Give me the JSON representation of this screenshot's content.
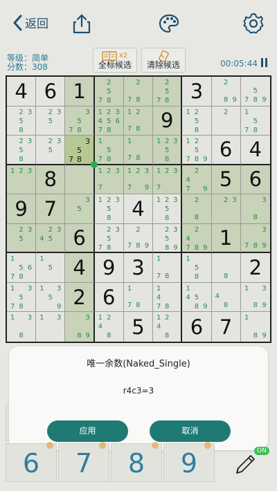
{
  "header": {
    "back_label": "返回",
    "icons": [
      "chevron-left-icon",
      "share-icon",
      "palette-icon",
      "gear-icon"
    ]
  },
  "info": {
    "level_label": "等级：",
    "level_value": "简单",
    "score_label": "分数：",
    "score_value": "308"
  },
  "tools": {
    "mark_all_label": "全标候选",
    "mark_all_badge": "x2",
    "clear_label": "清除候选"
  },
  "timer": "00:05:44",
  "board": {
    "values": [
      [
        "4",
        "6",
        "1",
        "",
        "",
        "",
        "3",
        "",
        ""
      ],
      [
        "",
        "",
        "",
        "",
        "",
        "9",
        "",
        "",
        ""
      ],
      [
        "",
        "",
        "",
        "",
        "",
        "",
        "",
        "6",
        "4"
      ],
      [
        "",
        "8",
        "",
        "",
        "",
        "",
        "",
        "5",
        "6"
      ],
      [
        "9",
        "7",
        "",
        "",
        "4",
        "",
        "",
        "",
        ""
      ],
      [
        "",
        "",
        "6",
        "",
        "",
        "",
        "",
        "1",
        ""
      ],
      [
        "",
        "",
        "4",
        "9",
        "3",
        "",
        "",
        "",
        "2"
      ],
      [
        "",
        "",
        "2",
        "6",
        "",
        "",
        "",
        "",
        ""
      ],
      [
        "",
        "",
        "",
        "",
        "5",
        "",
        "6",
        "7",
        ""
      ]
    ],
    "candidates": [
      [
        "",
        "",
        "",
        "2578",
        "278",
        "2578",
        "",
        "289",
        "5789"
      ],
      [
        "2358",
        "235",
        "3578",
        "12345678",
        "1278",
        "1256",
        "1258",
        "2",
        "1578"
      ],
      [
        "2358",
        "235",
        "3578",
        "1578",
        "178",
        "12358",
        "1259789",
        "",
        ""
      ],
      [
        "123",
        "",
        "",
        "1237",
        "12379",
        "1237",
        "2479",
        "",
        ""
      ],
      [
        "",
        "",
        "35",
        "12358",
        "",
        "12358",
        "28",
        "23",
        "38"
      ],
      [
        "235",
        "2345",
        "",
        "23578",
        "2789",
        "23589",
        "24789",
        "",
        "3789"
      ],
      [
        "15678",
        "15",
        "",
        "",
        "",
        "178",
        "158",
        "8",
        ""
      ],
      [
        "13578",
        "1359",
        "",
        "",
        "178",
        "1478",
        "14589",
        "48",
        "1389"
      ],
      [
        "138",
        "13",
        "389",
        "1248",
        "",
        "1248",
        "",
        "",
        "189"
      ]
    ],
    "selected_cell_candidates": "3\n5\n789",
    "highlight_color": "#c8d3b9",
    "selected_color": "#b7c992"
  },
  "hint_dialog": {
    "title": "唯一余数(Naked_Single)",
    "result": "r4c3=3",
    "apply_label": "应用",
    "cancel_label": "取消"
  },
  "numbers": [
    "6",
    "7",
    "8",
    "9"
  ],
  "pencil_badge": "ON",
  "colors": {
    "accent": "#1f7a74",
    "brand": "#1e4f73",
    "candidate": "#2b8a49"
  }
}
